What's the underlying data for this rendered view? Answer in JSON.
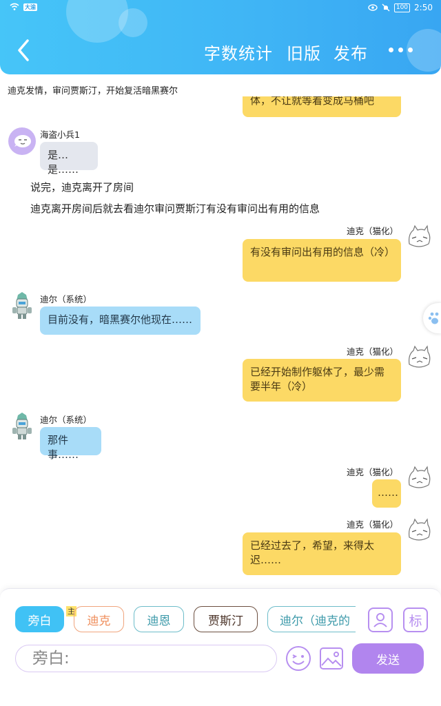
{
  "status_bar": {
    "carrier_badge": "大渝",
    "battery": "100",
    "time": "2:50"
  },
  "header": {
    "word_count": "字数统计",
    "old_version": "旧版",
    "publish": "发布"
  },
  "topic": "迪克发情，审问贾斯汀，开始复活暗黑赛尔",
  "cut_bubble_text": "体，不让就等着变成马桶吧",
  "messages": [
    {
      "name": "海盗小兵1",
      "text": "是…是……"
    },
    {
      "text": "说完，迪克离开了房间"
    },
    {
      "text": "迪克离开房间后就去看迪尔审问贾斯汀有没有审问出有用的信息"
    },
    {
      "name": "迪克（猫化）",
      "text": "有没有审问出有用的信息（冷）"
    },
    {
      "name": "迪尔（系统）",
      "text": "目前没有，暗黑赛尔他现在……"
    },
    {
      "name": "迪克（猫化）",
      "text": "已经开始制作躯体了，最少需要半年（冷）"
    },
    {
      "name": "迪尔（系统）",
      "text": "那件事……"
    },
    {
      "name": "迪克（猫化）",
      "text": "……"
    },
    {
      "name": "迪克（猫化）",
      "text": "已经过去了，希望，来得太迟……"
    }
  ],
  "roles": [
    {
      "label": "旁白"
    },
    {
      "label": "迪克",
      "badge": "主"
    },
    {
      "label": "迪恩"
    },
    {
      "label": "贾斯汀"
    },
    {
      "label": "迪尔（迪克的"
    }
  ],
  "tag_button": "标",
  "input": {
    "placeholder": "旁白:"
  },
  "send": "发送",
  "colors": {
    "header": "#3fb4f5",
    "accent_purple": "#b185ee",
    "bubble_yellow": "#fcd965",
    "bubble_blue": "#a8dcf8"
  }
}
